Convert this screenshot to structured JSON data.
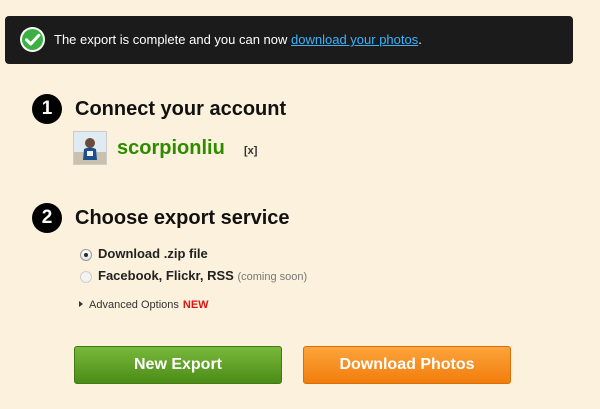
{
  "colors": {
    "page_background": "#fbf1dc",
    "banner_background": "#1b1b1b",
    "link": "#38b4ff",
    "username": "#2e8b00",
    "new_badge": "#e01212",
    "green_button": "#5a9e22",
    "orange_button": "#f58d1e"
  },
  "banner": {
    "icon": "check-circle-icon",
    "text": "The export is complete and you can now ",
    "link_text": "download your photos",
    "suffix": "."
  },
  "steps": [
    {
      "number": "1",
      "title": "Connect your account"
    },
    {
      "number": "2",
      "title": "Choose export service"
    }
  ],
  "account": {
    "avatar_icon": "user-avatar",
    "username": "scorpionliu",
    "remove_label": "[x]"
  },
  "export_options": [
    {
      "label": "Download .zip file",
      "note": "",
      "selected": true
    },
    {
      "label": "Facebook, Flickr, RSS",
      "note": "(coming soon)",
      "selected": false
    }
  ],
  "advanced": {
    "label": "Advanced Options",
    "badge": "NEW"
  },
  "buttons": {
    "new_export": "New Export",
    "download_photos": "Download Photos"
  }
}
